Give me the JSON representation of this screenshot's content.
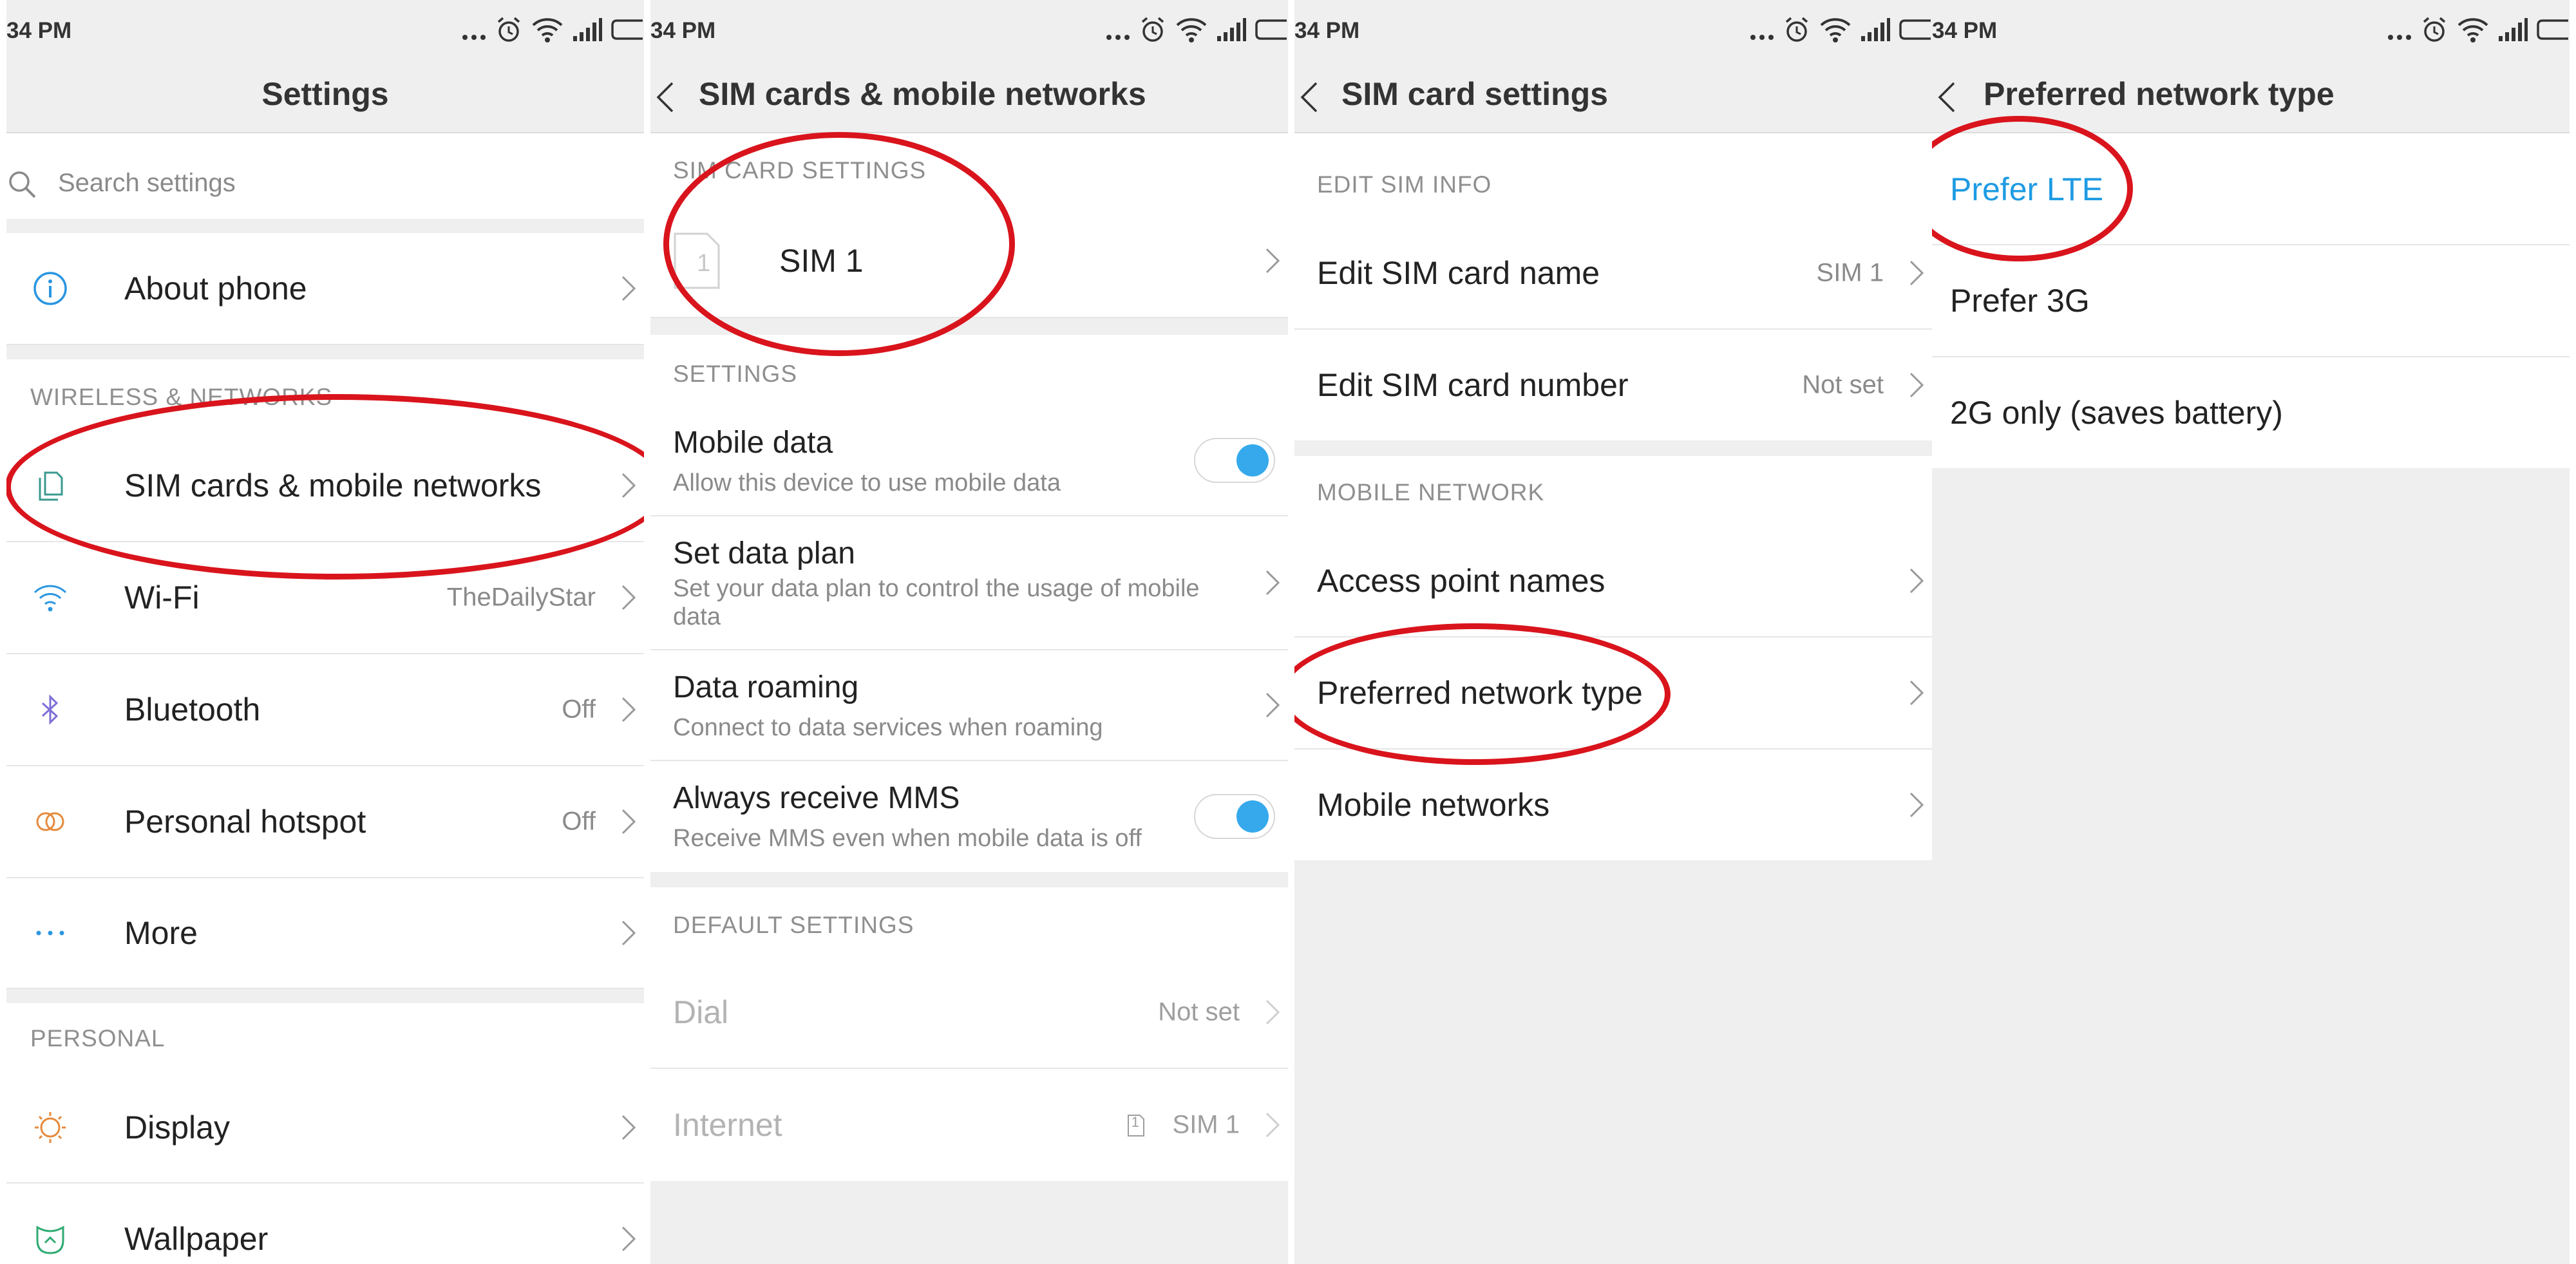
{
  "status_time": "34 PM",
  "colors": {
    "accent": "#1f9be3",
    "annotation": "#d9141c",
    "toggle_on": "#35a9ec"
  },
  "panel1": {
    "title": "Settings",
    "search_placeholder": "Search settings",
    "about_phone": "About phone",
    "section_wireless": "WIRELESS & NETWORKS",
    "sim_networks": "SIM cards & mobile networks",
    "wifi": "Wi-Fi",
    "wifi_value": "TheDailyStar",
    "bluetooth": "Bluetooth",
    "bluetooth_value": "Off",
    "hotspot": "Personal hotspot",
    "hotspot_value": "Off",
    "more": "More",
    "section_personal": "PERSONAL",
    "display": "Display",
    "wallpaper": "Wallpaper"
  },
  "panel2": {
    "title": "SIM cards & mobile networks",
    "section_sim": "SIM CARD SETTINGS",
    "sim_number": "1",
    "sim1": "SIM 1",
    "section_settings": "SETTINGS",
    "mobile_data": "Mobile data",
    "mobile_data_sub": "Allow this device to use mobile data",
    "data_plan": "Set data plan",
    "data_plan_sub": "Set your data plan to control the usage of mobile data",
    "roaming": "Data roaming",
    "roaming_sub": "Connect to data services when roaming",
    "mms": "Always receive MMS",
    "mms_sub": "Receive MMS even when mobile data is off",
    "section_default": "DEFAULT SETTINGS",
    "dial": "Dial",
    "dial_value": "Not set",
    "internet": "Internet",
    "internet_sim_number": "1",
    "internet_value": "SIM 1"
  },
  "panel3": {
    "title": "SIM card settings",
    "section_edit": "EDIT SIM INFO",
    "edit_name": "Edit SIM card name",
    "edit_name_value": "SIM 1",
    "edit_number": "Edit SIM card number",
    "edit_number_value": "Not set",
    "section_mobile": "MOBILE NETWORK",
    "apn": "Access point names",
    "preferred": "Preferred network type",
    "mobile_networks": "Mobile networks"
  },
  "panel4": {
    "title": "Preferred network type",
    "prefer_lte": "Prefer LTE",
    "prefer_3g": "Prefer 3G",
    "only_2g": "2G only (saves battery)"
  }
}
